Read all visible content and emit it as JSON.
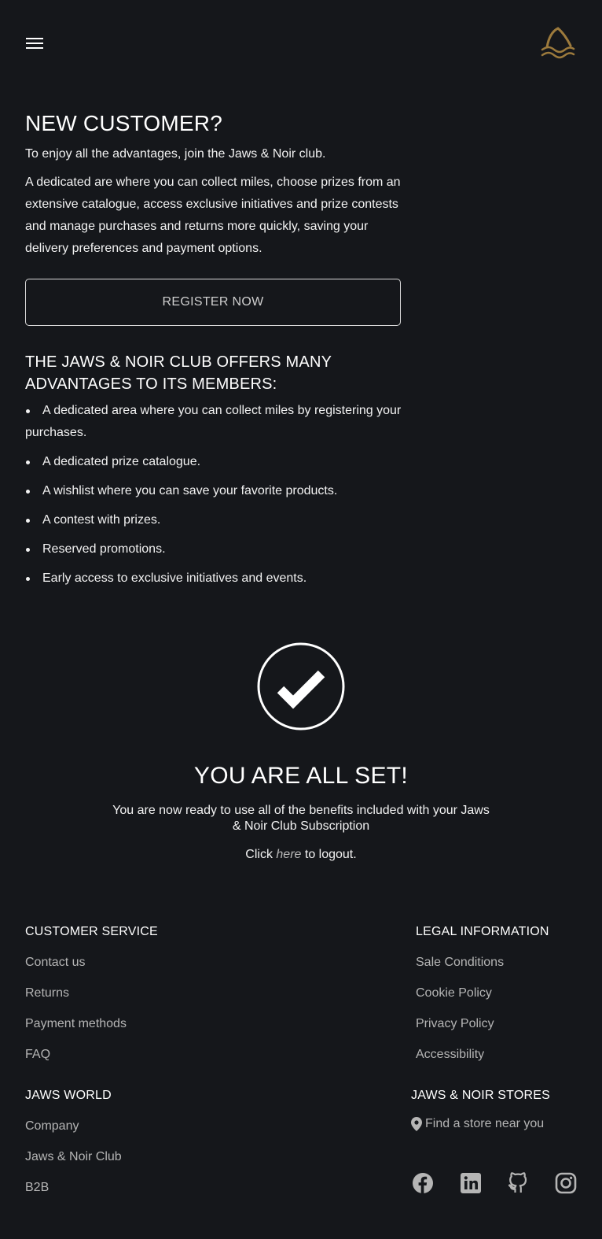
{
  "header": {
    "menu_icon": "hamburger-menu-icon",
    "logo_icon": "shark-fin-waves-logo",
    "logo_color": "#9c7a3c"
  },
  "new_customer": {
    "title": "NEW CUSTOMER?",
    "intro": "To enjoy all the advantages, join the Jaws & Noir club.",
    "description": "A dedicated are where you can collect miles, choose prizes from an extensive catalogue, access exclusive initiatives and prize contests and manage purchases and returns more quickly, saving your delivery preferences and payment options.",
    "register_label": "REGISTER NOW"
  },
  "advantages": {
    "title": "THE JAWS & NOIR CLUB OFFERS MANY ADVANTAGES TO ITS MEMBERS:",
    "items": [
      "A dedicated area where you can collect miles by registering your purchases.",
      "A dedicated prize catalogue.",
      "A wishlist where you can save your favorite products.",
      "A contest with prizes.",
      "Reserved promotions.",
      "Early access to exclusive initiatives and events."
    ]
  },
  "success": {
    "icon": "check-circle-icon",
    "title": "YOU ARE ALL SET!",
    "text": "You are now ready to use all of the benefits included with your Jaws & Noir Club Subscription",
    "logout_prefix": "Click ",
    "logout_link": "here",
    "logout_suffix": " to logout."
  },
  "footer": {
    "customer_service": {
      "title": "CUSTOMER SERVICE",
      "links": [
        "Contact us",
        "Returns",
        "Payment methods",
        "FAQ"
      ]
    },
    "legal": {
      "title": "LEGAL INFORMATION",
      "links": [
        "Sale Conditions",
        "Cookie Policy",
        "Privacy Policy",
        "Accessibility"
      ]
    },
    "jaws_world": {
      "title": "JAWS WORLD",
      "links": [
        "Company",
        "Jaws & Noir Club",
        "B2B"
      ]
    },
    "stores": {
      "title": "JAWS & NOIR STORES",
      "link": "Find a store near you",
      "icon": "map-pin-icon"
    },
    "socials": [
      "facebook-icon",
      "linkedin-icon",
      "github-icon",
      "instagram-icon"
    ]
  },
  "colors": {
    "background": "#15171b",
    "text": "#f2f2f2",
    "muted": "#b5b5b5",
    "accent": "#9c7a3c"
  }
}
